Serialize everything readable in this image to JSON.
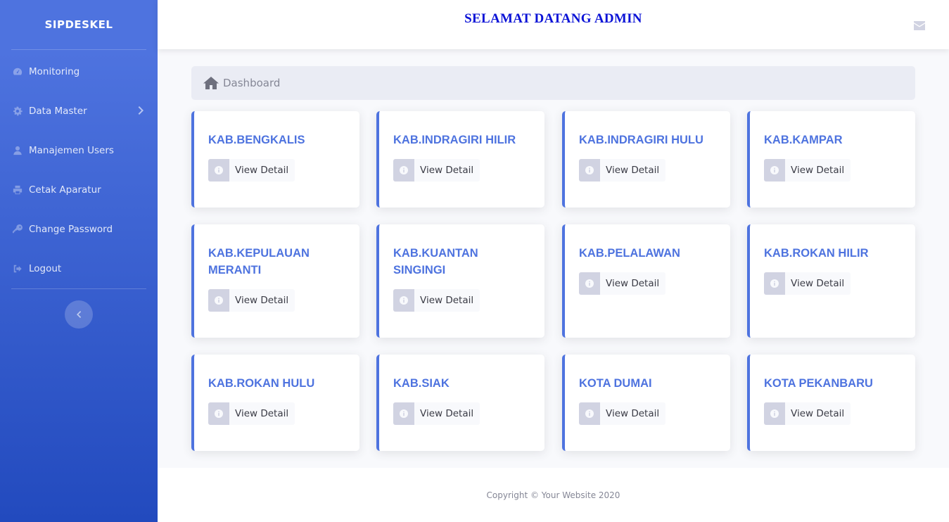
{
  "sidebar": {
    "brand": "SIPDESKEL",
    "items": [
      {
        "label": "Monitoring",
        "icon": "tachometer-icon"
      },
      {
        "label": "Data Master",
        "icon": "cog-icon",
        "has_submenu": true
      },
      {
        "label": "Manajemen Users",
        "icon": "user-icon"
      },
      {
        "label": "Cetak Aparatur",
        "icon": "print-icon"
      },
      {
        "label": "Change Password",
        "icon": "key-icon"
      },
      {
        "label": "Logout",
        "icon": "sign-out-icon"
      }
    ]
  },
  "topbar": {
    "welcome": "SELAMAT DATANG ADMIN",
    "mail_icon": "envelope-icon"
  },
  "breadcrumb": {
    "label": "Dashboard",
    "icon": "home-icon"
  },
  "cards": [
    {
      "title": "KAB.BENGKALIS",
      "button": "View Detail"
    },
    {
      "title": "KAB.INDRAGIRI HILIR",
      "button": "View Detail"
    },
    {
      "title": "KAB.INDRAGIRI HULU",
      "button": "View Detail"
    },
    {
      "title": "KAB.KAMPAR",
      "button": "View Detail"
    },
    {
      "title": "KAB.KEPULAUAN MERANTI",
      "button": "View Detail"
    },
    {
      "title": "KAB.KUANTAN SINGINGI",
      "button": "View Detail"
    },
    {
      "title": "KAB.PELALAWAN",
      "button": "View Detail"
    },
    {
      "title": "KAB.ROKAN HILIR",
      "button": "View Detail"
    },
    {
      "title": "KAB.ROKAN HULU",
      "button": "View Detail"
    },
    {
      "title": "KAB.SIAK",
      "button": "View Detail"
    },
    {
      "title": "KOTA DUMAI",
      "button": "View Detail"
    },
    {
      "title": "KOTA PEKANBARU",
      "button": "View Detail"
    }
  ],
  "footer": {
    "copyright": "Copyright © Your Website 2020"
  },
  "colors": {
    "primary": "#4e73df",
    "sidebar_dark": "#224abe",
    "welcome_text": "#0a12d6"
  }
}
